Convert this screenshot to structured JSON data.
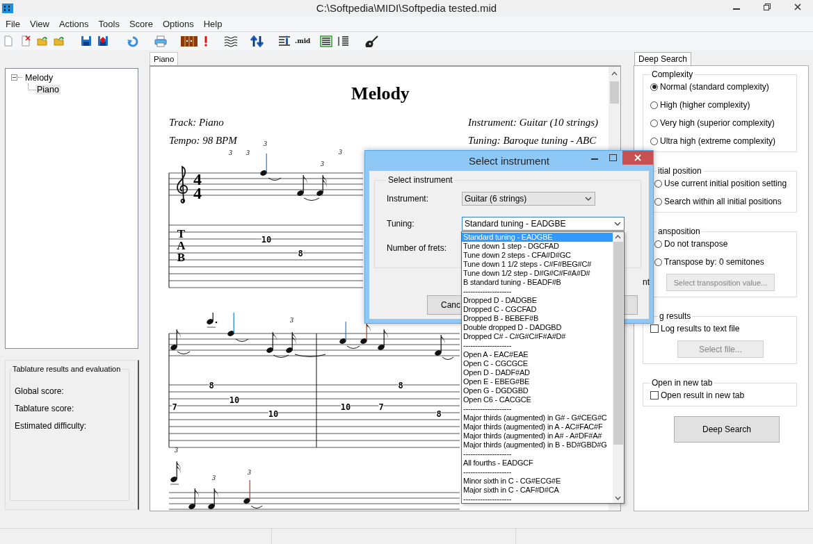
{
  "window": {
    "title": "C:\\Softpedia\\MIDI\\Softpedia tested.mid"
  },
  "menu": [
    "File",
    "View",
    "Actions",
    "Tools",
    "Score",
    "Options",
    "Help"
  ],
  "toolbar": {
    "mid_label": ".mid"
  },
  "tree": [
    {
      "label": "Melody",
      "expanded": true,
      "selected": false,
      "children": [
        {
          "label": "Piano",
          "selected": true
        }
      ]
    }
  ],
  "evaluation": {
    "title": "Tablature results and evaluation",
    "fields": [
      "Global score:",
      "Tablature score:",
      "Estimated difficulty:"
    ]
  },
  "score_tabs": [
    {
      "label": "Piano",
      "selected": true
    }
  ],
  "score": {
    "title": "Melody",
    "track": "Track: Piano",
    "tempo": "Tempo: 98 BPM",
    "instrument": "Instrument: Guitar (10 strings)",
    "tuning": "Tuning: Baroque tuning - ABC",
    "time_signature": [
      "4",
      "4"
    ],
    "tab_clef": "TAB",
    "triplet_marks": [
      "3",
      "3",
      "3",
      "3",
      "3",
      "3",
      "3",
      "3",
      "3"
    ],
    "tab_numbers": [
      "10",
      "8",
      "7",
      "8",
      "10",
      "10",
      "10",
      "7",
      "8",
      "8"
    ]
  },
  "side_tabs": [
    {
      "label": "Deep Search",
      "selected": true
    }
  ],
  "deep_search": {
    "groups": [
      {
        "legend": "Complexity",
        "options": [
          {
            "kind": "radio",
            "label": "Normal (standard complexity)",
            "selected": true
          },
          {
            "kind": "radio",
            "label": "High (higher complexity)",
            "selected": false
          },
          {
            "kind": "radio",
            "label": "Very high (superior complexity)",
            "selected": false
          },
          {
            "kind": "radio",
            "label": "Ultra high (extreme complexity)",
            "selected": false
          }
        ]
      },
      {
        "legend": "itial position",
        "options": [
          {
            "kind": "radio",
            "label": "Use current initial position setting",
            "selected": false
          },
          {
            "kind": "radio",
            "label": "Search within all initial positions",
            "selected": false
          }
        ]
      },
      {
        "legend": "ansposition",
        "options": [
          {
            "kind": "radio",
            "label": "Do not transpose",
            "selected": false
          },
          {
            "kind": "radio",
            "label": "Transpose by: 0 semitones",
            "selected": false
          },
          {
            "kind": "button",
            "label": "Select transposition value...",
            "disabled": true
          }
        ]
      },
      {
        "legend": "g results",
        "options": [
          {
            "kind": "checkbox",
            "label": "Log results to text file",
            "checked": false
          },
          {
            "kind": "button",
            "label": "Select file...",
            "disabled": true
          }
        ]
      },
      {
        "legend": "Open in new tab",
        "options": [
          {
            "kind": "checkbox",
            "label": "Open result in new tab",
            "checked": false
          }
        ]
      }
    ],
    "button": "Deep Search"
  },
  "dialog": {
    "title": "Select instrument",
    "group": "Select instrument",
    "instrument_label": "Instrument:",
    "instrument_value": "Guitar (6 strings)",
    "tuning_label": "Tuning:",
    "tuning_value": "Standard tuning - EADGBE",
    "frets_label": "Number of frets:",
    "partial_text": "nt",
    "cancel_button": "Canc"
  },
  "tuning_list": [
    {
      "kind": "option",
      "label": "Standard tuning - EADGBE",
      "selected": true
    },
    {
      "kind": "option",
      "label": "Tune down 1 step - DGCFAD",
      "selected": false
    },
    {
      "kind": "option",
      "label": "Tune down 2 steps - CFA#D#GC",
      "selected": false
    },
    {
      "kind": "option",
      "label": "Tune down 1 1/2 steps - C#F#BEG#C#",
      "selected": false
    },
    {
      "kind": "option",
      "label": "Tune down 1/2 step - D#G#C#F#A#D#",
      "selected": false
    },
    {
      "kind": "option",
      "label": "B standard tuning - BEADF#B",
      "selected": false
    },
    {
      "kind": "separator",
      "label": "--------------------"
    },
    {
      "kind": "option",
      "label": "Dropped D - DADGBE",
      "selected": false
    },
    {
      "kind": "option",
      "label": "Dropped C - CGCFAD",
      "selected": false
    },
    {
      "kind": "option",
      "label": "Dropped B - BEBEF#B",
      "selected": false
    },
    {
      "kind": "option",
      "label": "Double dropped D - DADGBD",
      "selected": false
    },
    {
      "kind": "option",
      "label": "Dropped C# - C#G#C#F#A#D#",
      "selected": false
    },
    {
      "kind": "separator",
      "label": "--------------------"
    },
    {
      "kind": "option",
      "label": "Open A - EAC#EAE",
      "selected": false
    },
    {
      "kind": "option",
      "label": "Open C - CGCGCE",
      "selected": false
    },
    {
      "kind": "option",
      "label": "Open D - DADF#AD",
      "selected": false
    },
    {
      "kind": "option",
      "label": "Open E - EBEG#BE",
      "selected": false
    },
    {
      "kind": "option",
      "label": "Open G - DGDGBD",
      "selected": false
    },
    {
      "kind": "option",
      "label": "Open C6 - CACGCE",
      "selected": false
    },
    {
      "kind": "separator",
      "label": "--------------------"
    },
    {
      "kind": "option",
      "label": "Major thirds (augmented) in G# - G#CEG#C",
      "selected": false
    },
    {
      "kind": "option",
      "label": "Major thirds (augmented) in A - AC#FAC#F",
      "selected": false
    },
    {
      "kind": "option",
      "label": "Major thirds (augmented) in A# - A#DF#A#",
      "selected": false
    },
    {
      "kind": "option",
      "label": "Major thirds (augmented) in B - BD#GBD#G",
      "selected": false
    },
    {
      "kind": "separator",
      "label": "--------------------"
    },
    {
      "kind": "option",
      "label": "All fourths - EADGCF",
      "selected": false
    },
    {
      "kind": "separator",
      "label": "--------------------"
    },
    {
      "kind": "option",
      "label": "Minor sixth in C - CG#ECG#E",
      "selected": false
    },
    {
      "kind": "option",
      "label": "Major sixth in C - CAF#D#CA",
      "selected": false
    },
    {
      "kind": "separator",
      "label": "--------------------"
    }
  ]
}
